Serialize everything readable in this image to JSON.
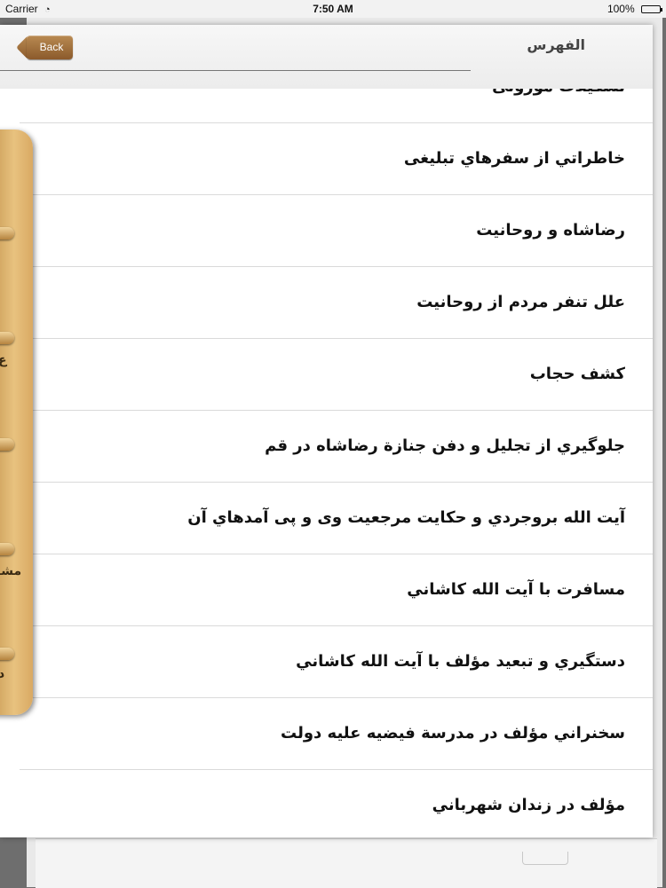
{
  "status_bar": {
    "carrier": "Carrier",
    "time": "7:50 AM",
    "battery": "100%",
    "battery_level": 1.0
  },
  "nav": {
    "title": "الفهرس",
    "back_label": "Back"
  },
  "list": {
    "items": [
      {
        "label": "تشکیلات موروثی"
      },
      {
        "label": "خاطراتي از سفرهاي تبليغی"
      },
      {
        "label": "رضاشاه و روحانيت"
      },
      {
        "label": "علل تنفر مردم از روحانيت"
      },
      {
        "label": "كشف حجاب"
      },
      {
        "label": "جلوگيري از تجليل و دفن جنازة رضاشاه در قم"
      },
      {
        "label": "آيت الله بروجردي و حكايت مرجعيت وی و پی آمدهاي آن"
      },
      {
        "label": "مسافرت با آيت الله كاشاني"
      },
      {
        "label": "دستگيري و تبعيد مؤلف با آيت الله كاشاني"
      },
      {
        "label": "سخنراني مؤلف در مدرسة فيضيه عليه دولت"
      },
      {
        "label": "مؤلف در زندان شهرباني"
      }
    ]
  },
  "side_drawer": {
    "labels": [
      "ع",
      "مشا",
      "د"
    ]
  }
}
